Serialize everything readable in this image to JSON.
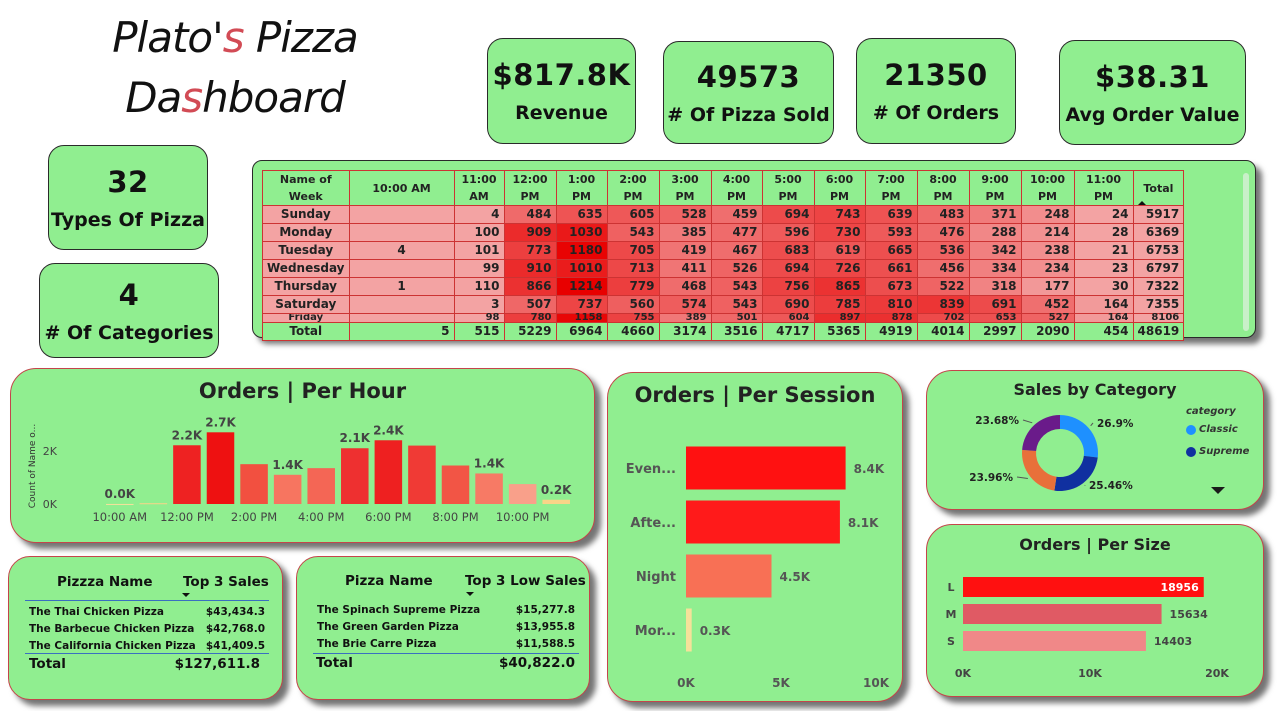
{
  "title": {
    "line1_a": "Plato'",
    "line1_hl": "s",
    "line1_b": " Pizza",
    "line2_a": "Da",
    "line2_hl": "s",
    "line2_b": "hboard"
  },
  "kpis": [
    {
      "value": "$817.8K",
      "label": "Revenue"
    },
    {
      "value": "49573",
      "label": "# Of Pizza Sold"
    },
    {
      "value": "21350",
      "label": "# Of Orders"
    },
    {
      "value": "$38.31",
      "label": "Avg Order Value"
    },
    {
      "value": "32",
      "label": "Types Of Pizza"
    },
    {
      "value": "4",
      "label": "# Of Categories"
    }
  ],
  "matrix": {
    "headers": [
      "Name of Week",
      "10:00 AM",
      "11:00 AM",
      "12:00 PM",
      "1:00 PM",
      "2:00 PM",
      "3:00 PM",
      "4:00 PM",
      "5:00 PM",
      "6:00 PM",
      "7:00 PM",
      "8:00 PM",
      "9:00 PM",
      "10:00 PM",
      "11:00 PM",
      "Total"
    ],
    "rows": [
      {
        "day": "Sunday",
        "values": [
          "",
          "4",
          "484",
          "635",
          "605",
          "528",
          "459",
          "694",
          "743",
          "639",
          "483",
          "371",
          "248",
          "24",
          "5917"
        ]
      },
      {
        "day": "Monday",
        "values": [
          "",
          "100",
          "909",
          "1030",
          "543",
          "385",
          "477",
          "596",
          "730",
          "593",
          "476",
          "288",
          "214",
          "28",
          "6369"
        ]
      },
      {
        "day": "Tuesday",
        "values": [
          "4",
          "101",
          "773",
          "1180",
          "705",
          "419",
          "467",
          "683",
          "619",
          "665",
          "536",
          "342",
          "238",
          "21",
          "6753"
        ]
      },
      {
        "day": "Wednesday",
        "values": [
          "",
          "99",
          "910",
          "1010",
          "713",
          "411",
          "526",
          "694",
          "726",
          "661",
          "456",
          "334",
          "234",
          "23",
          "6797"
        ]
      },
      {
        "day": "Thursday",
        "values": [
          "1",
          "110",
          "866",
          "1214",
          "779",
          "468",
          "543",
          "756",
          "865",
          "673",
          "522",
          "318",
          "177",
          "30",
          "7322"
        ]
      },
      {
        "day": "Saturday",
        "values": [
          "",
          "3",
          "507",
          "737",
          "560",
          "574",
          "543",
          "690",
          "785",
          "810",
          "839",
          "691",
          "452",
          "164",
          "7355"
        ]
      },
      {
        "day": "Friday",
        "values": [
          "",
          "98",
          "780",
          "1158",
          "755",
          "389",
          "501",
          "604",
          "897",
          "878",
          "702",
          "653",
          "527",
          "164",
          "8106"
        ]
      }
    ],
    "total_label": "Total",
    "totals": [
      "5",
      "515",
      "5229",
      "6964",
      "4660",
      "3174",
      "3516",
      "4717",
      "5365",
      "4919",
      "4014",
      "2997",
      "2090",
      "454",
      "48619"
    ]
  },
  "chart_data": [
    {
      "type": "bar",
      "title": "Orders | Per Hour",
      "ylabel": "Count of Name o...",
      "y_ticks": [
        "0K",
        "2K"
      ],
      "x_tick_labels": [
        "10:00 AM",
        "12:00 PM",
        "2:00 PM",
        "4:00 PM",
        "6:00 PM",
        "8:00 PM",
        "10:00 PM"
      ],
      "categories": [
        "10:00 AM",
        "11:00 AM",
        "12:00 PM",
        "1:00 PM",
        "2:00 PM",
        "3:00 PM",
        "4:00 PM",
        "5:00 PM",
        "6:00 PM",
        "7:00 PM",
        "8:00 PM",
        "9:00 PM",
        "10:00 PM",
        "11:00 PM"
      ],
      "values": [
        5,
        515,
        5229,
        6964,
        4660,
        3174,
        3516,
        4717,
        5365,
        4919,
        4014,
        2997,
        2090,
        454
      ],
      "display_values": [
        2,
        29,
        2212,
        2700,
        1500,
        1100,
        1350,
        2100,
        2400,
        2200,
        1450,
        1150,
        750,
        160
      ],
      "data_labels": [
        "0.0K",
        "",
        "2.2K",
        "2.7K",
        "",
        "1.4K",
        "",
        "2.1K",
        "2.4K",
        "",
        "",
        "1.4K",
        "",
        "0.2K"
      ],
      "ylim": [
        0,
        2900
      ],
      "colors": [
        "#f5e19a",
        "#f8d488",
        "#ee2222",
        "#ee1111",
        "#f25040",
        "#f77560",
        "#f46655",
        "#ee3030",
        "#ee2020",
        "#f03a35",
        "#f25545",
        "#f77a65",
        "#f9a08a",
        "#f8d488"
      ]
    },
    {
      "type": "bar",
      "orientation": "horizontal",
      "title": "Orders | Per Session",
      "categories": [
        "Even...",
        "Afte...",
        "Night",
        "Mor..."
      ],
      "values": [
        8400,
        8100,
        4500,
        300
      ],
      "data_labels": [
        "8.4K",
        "8.1K",
        "4.5K",
        "0.3K"
      ],
      "x_ticks": [
        "0K",
        "5K",
        "10K"
      ],
      "xlim": [
        0,
        10000
      ],
      "colors": [
        "#ff1111",
        "#ff1a1a",
        "#f87055",
        "#f5e19a"
      ]
    },
    {
      "type": "pie",
      "title": "Sales by Category",
      "legend_title": "category",
      "legend": [
        {
          "name": "Classic",
          "color": "#1e90ff"
        },
        {
          "name": "Supreme",
          "color": "#1030a0"
        }
      ],
      "slices": [
        {
          "label": "26.9%",
          "value": 26.9,
          "color": "#1e90ff"
        },
        {
          "label": "25.46%",
          "value": 25.46,
          "color": "#1030a0"
        },
        {
          "label": "23.96%",
          "value": 23.96,
          "color": "#e8703a"
        },
        {
          "label": "23.68%",
          "value": 23.68,
          "color": "#6a1b8a"
        }
      ]
    },
    {
      "type": "bar",
      "orientation": "horizontal",
      "title": "Orders | Per Size",
      "categories": [
        "L",
        "M",
        "S"
      ],
      "values": [
        18956,
        15634,
        14403
      ],
      "data_labels": [
        "18956",
        "15634",
        "14403"
      ],
      "x_ticks": [
        "0K",
        "10K",
        "20K"
      ],
      "xlim": [
        0,
        20000
      ],
      "colors": [
        "#ff1010",
        "#e05a64",
        "#f08888"
      ]
    }
  ],
  "top_sales": {
    "col1": "Pizzza Name",
    "col2": "Top 3 Sales",
    "rows": [
      {
        "name": "The Thai Chicken Pizza",
        "value": "$43,434.3"
      },
      {
        "name": "The Barbecue Chicken Pizza",
        "value": "$42,768.0"
      },
      {
        "name": "The California Chicken Pizza",
        "value": "$41,409.5"
      }
    ],
    "total_label": "Total",
    "total": "$127,611.8"
  },
  "low_sales": {
    "col1": "Pizza Name",
    "col2": "Top 3 Low Sales",
    "rows": [
      {
        "name": "The Spinach Supreme Pizza",
        "value": "$15,277.8"
      },
      {
        "name": "The Green Garden Pizza",
        "value": "$13,955.8"
      },
      {
        "name": "The Brie Carre Pizza",
        "value": "$11,588.5"
      }
    ],
    "total_label": "Total",
    "total": "$40,822.0"
  },
  "colors": {
    "card_bg": "#90ee90",
    "accent": "#d24b55"
  }
}
